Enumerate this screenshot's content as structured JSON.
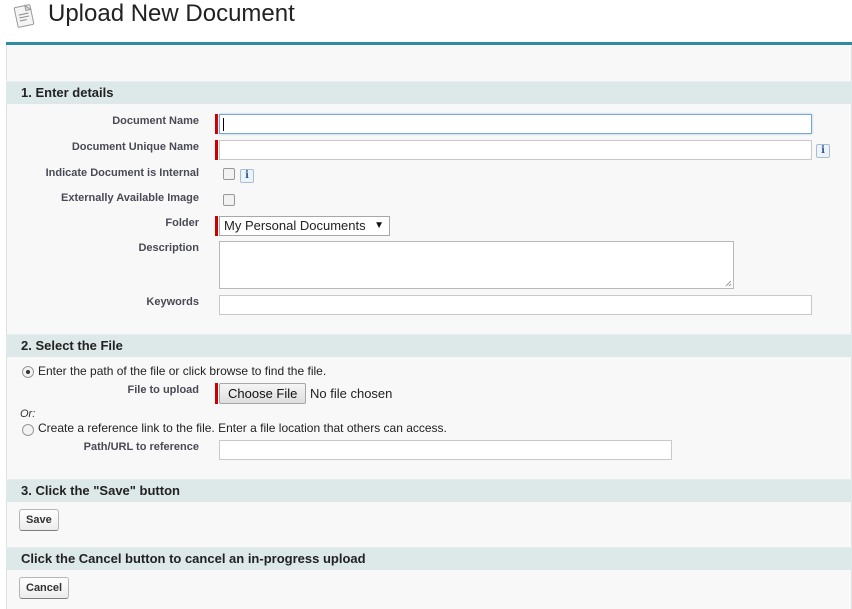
{
  "page": {
    "title": "Upload New Document",
    "icon": "document-icon"
  },
  "sections": {
    "details": {
      "title": "1. Enter details"
    },
    "file": {
      "title": "2. Select the File"
    },
    "save": {
      "title": "3. Click the \"Save\" button"
    },
    "cancel": {
      "title": "Click the Cancel button to cancel an in-progress upload"
    }
  },
  "fields": {
    "document_name": {
      "label": "Document Name",
      "value": "",
      "required": true
    },
    "document_unique_name": {
      "label": "Document Unique Name",
      "value": "",
      "required": true
    },
    "internal": {
      "label": "Indicate Document is Internal",
      "checked": false
    },
    "external_image": {
      "label": "Externally Available Image",
      "checked": false
    },
    "folder": {
      "label": "Folder",
      "selected": "My Personal Documents",
      "required": true
    },
    "description": {
      "label": "Description",
      "value": ""
    },
    "keywords": {
      "label": "Keywords",
      "value": ""
    }
  },
  "file_select": {
    "option_upload": "Enter the path of the file or click browse to find the file.",
    "file_label": "File to upload",
    "choose_button": "Choose File",
    "no_file": "No file chosen",
    "or_label": "Or:",
    "option_reference": "Create a reference link to the file. Enter a file location that others can access.",
    "path_label": "Path/URL to reference",
    "path_value": ""
  },
  "buttons": {
    "save": "Save",
    "cancel": "Cancel",
    "info": "i"
  },
  "colors": {
    "accent_rule": "#2f8aa3",
    "section_band": "#dde8e8",
    "required": "#cc0000"
  }
}
